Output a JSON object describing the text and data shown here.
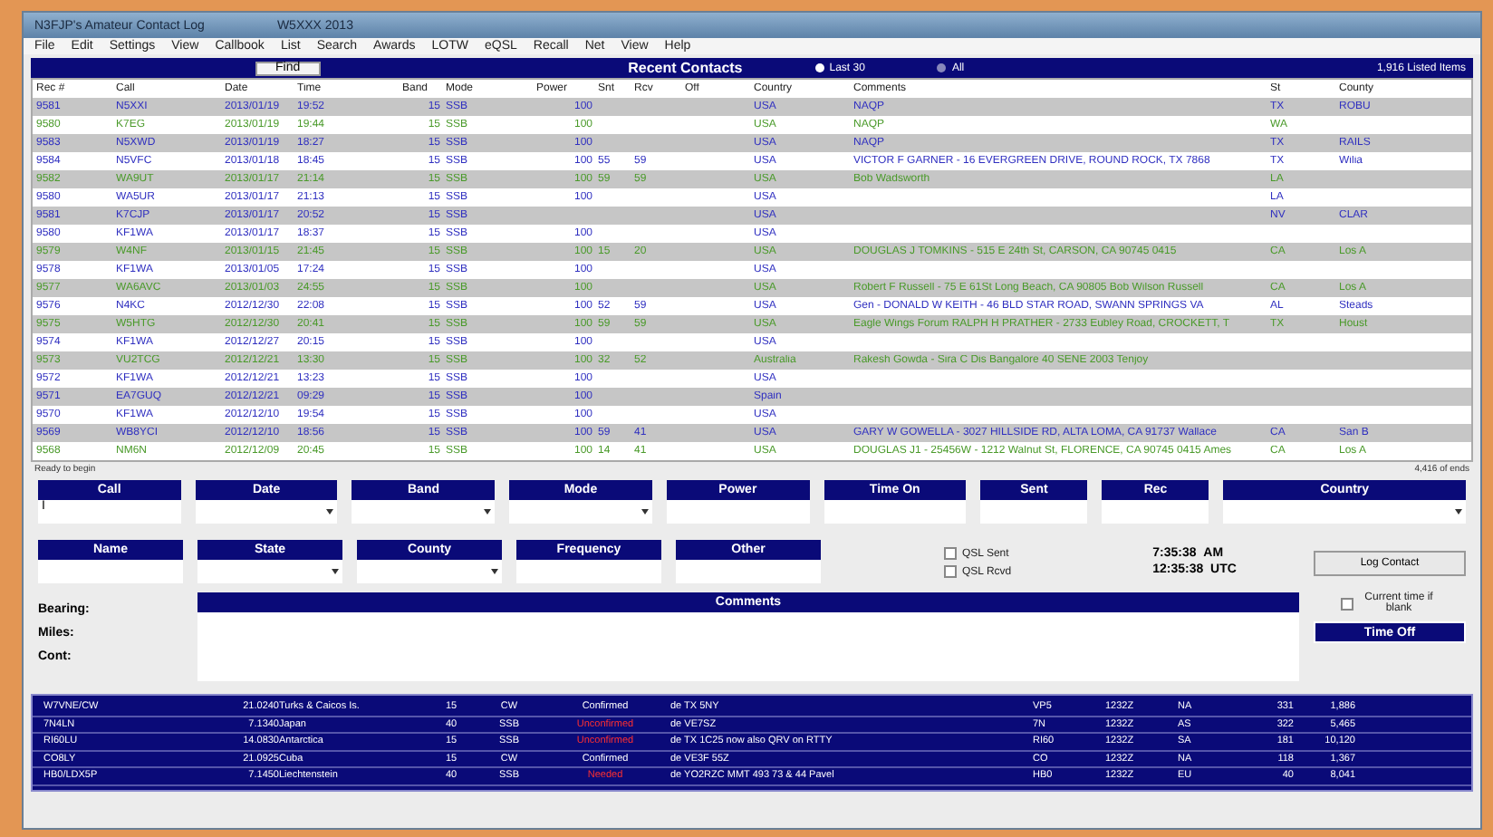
{
  "window": {
    "title": "N3FJP's Amateur Contact Log",
    "subtitle": "W5XXX 2013"
  },
  "menu": [
    "File",
    "Edit",
    "Settings",
    "View",
    "Callbook",
    "List",
    "Search",
    "Awards",
    "LOTW",
    "eQSL",
    "Recall",
    "Net",
    "View",
    "Help"
  ],
  "header": {
    "find_button": "Find",
    "title": "Recent Contacts",
    "filters": [
      {
        "label": "Last 30",
        "selected": true
      },
      {
        "label": "All",
        "selected": false
      }
    ],
    "count": "1,916 Listed Items"
  },
  "columns": [
    "Rec #",
    "Call",
    "Date",
    "Time",
    "Band",
    "Mode",
    "Power",
    "Snt",
    "Rcv",
    "Off",
    "Country",
    "Comments",
    "St",
    "County"
  ],
  "rows": [
    {
      "cells": [
        "9581",
        "N5XXI",
        "2013/01/19",
        "19:52",
        "15",
        "SSB",
        "100",
        null,
        null,
        null,
        "USA",
        "NAQP",
        "TX",
        "ROBU"
      ],
      "color": "#3030c0"
    },
    {
      "cells": [
        "9580",
        "K7EG",
        "2013/01/19",
        "19:44",
        "15",
        "SSB",
        "100",
        null,
        null,
        null,
        "USA",
        "NAQP",
        "WA",
        null
      ],
      "color": "#4a9a2a"
    },
    {
      "cells": [
        "9583",
        "N5XWD",
        "2013/01/19",
        "18:27",
        "15",
        "SSB",
        "100",
        null,
        null,
        null,
        "USA",
        "NAQP",
        "TX",
        "RAILS"
      ],
      "color": "#3030c0"
    },
    {
      "cells": [
        "9584",
        "N5VFC",
        "2013/01/18",
        "18:45",
        "15",
        "SSB",
        "100",
        "55",
        "59",
        null,
        "USA",
        "VICTOR F GARNER - 16 EVERGREEN DRIVE, ROUND ROCK, TX 7868",
        "TX",
        "Wilia"
      ],
      "color": "#3030c0"
    },
    {
      "cells": [
        "9582",
        "WA9UT",
        "2013/01/17",
        "21:14",
        "15",
        "SSB",
        "100",
        "59",
        "59",
        null,
        "USA",
        "Bob Wadsworth",
        "LA",
        null
      ],
      "color": "#4a9a2a"
    },
    {
      "cells": [
        "9580",
        "WA5UR",
        "2013/01/17",
        "21:13",
        "15",
        "SSB",
        "100",
        null,
        null,
        null,
        "USA",
        null,
        "LA",
        null
      ],
      "color": "#3030c0"
    },
    {
      "cells": [
        "9581",
        "K7CJP",
        "2013/01/17",
        "20:52",
        "15",
        "SSB",
        null,
        null,
        null,
        null,
        "USA",
        null,
        "NV",
        "CLAR"
      ],
      "color": "#3030c0"
    },
    {
      "cells": [
        "9580",
        "KF1WA",
        "2013/01/17",
        "18:37",
        "15",
        "SSB",
        "100",
        null,
        null,
        null,
        "USA",
        null,
        null,
        null
      ],
      "color": "#3030c0"
    },
    {
      "cells": [
        "9579",
        "W4NF",
        "2013/01/15",
        "21:45",
        "15",
        "SSB",
        "100",
        "15",
        "20",
        null,
        "USA",
        "DOUGLAS J TOMKINS - 515 E 24th St, CARSON, CA 90745 0415",
        "CA",
        "Los A"
      ],
      "color": "#4a9a2a"
    },
    {
      "cells": [
        "9578",
        "KF1WA",
        "2013/01/05",
        "17:24",
        "15",
        "SSB",
        "100",
        null,
        null,
        null,
        "USA",
        null,
        null,
        null
      ],
      "color": "#3030c0"
    },
    {
      "cells": [
        "9577",
        "WA6AVC",
        "2013/01/03",
        "24:55",
        "15",
        "SSB",
        "100",
        null,
        null,
        null,
        "USA",
        "Robert F Russell - 75 E 61St Long Beach, CA 90805 Bob Wilson Russell",
        "CA",
        "Los A"
      ],
      "color": "#4a9a2a"
    },
    {
      "cells": [
        "9576",
        "N4KC",
        "2012/12/30",
        "22:08",
        "15",
        "SSB",
        "100",
        "52",
        "59",
        null,
        "USA",
        "Gen - DONALD W KEITH - 46 BLD STAR ROAD, SWANN SPRINGS VA",
        "AL",
        "Steads"
      ],
      "color": "#3030c0"
    },
    {
      "cells": [
        "9575",
        "W5HTG",
        "2012/12/30",
        "20:41",
        "15",
        "SSB",
        "100",
        "59",
        "59",
        null,
        "USA",
        "Eagle Wings Forum RALPH H PRATHER - 2733 Eubley Road, CROCKETT, T",
        "TX",
        "Houst"
      ],
      "color": "#4a9a2a"
    },
    {
      "cells": [
        "9574",
        "KF1WA",
        "2012/12/27",
        "20:15",
        "15",
        "SSB",
        "100",
        null,
        null,
        null,
        "USA",
        null,
        null,
        null
      ],
      "color": "#3030c0"
    },
    {
      "cells": [
        "9573",
        "VU2TCG",
        "2012/12/21",
        "13:30",
        "15",
        "SSB",
        "100",
        "32",
        "52",
        null,
        "Australia",
        "Rakesh Gowda - Sira C Dis Bangalore 40 SENE 2003 Tenjoy",
        null,
        null
      ],
      "color": "#4a9a2a"
    },
    {
      "cells": [
        "9572",
        "KF1WA",
        "2012/12/21",
        "13:23",
        "15",
        "SSB",
        "100",
        null,
        null,
        null,
        "USA",
        null,
        null,
        null
      ],
      "color": "#3030c0"
    },
    {
      "cells": [
        "9571",
        "EA7GUQ",
        "2012/12/21",
        "09:29",
        "15",
        "SSB",
        "100",
        null,
        null,
        null,
        "Spain",
        null,
        null,
        null
      ],
      "color": "#3030c0"
    },
    {
      "cells": [
        "9570",
        "KF1WA",
        "2012/12/10",
        "19:54",
        "15",
        "SSB",
        "100",
        null,
        null,
        null,
        "USA",
        null,
        null,
        null
      ],
      "color": "#3030c0"
    },
    {
      "cells": [
        "9569",
        "WB8YCI",
        "2012/12/10",
        "18:56",
        "15",
        "SSB",
        "100",
        "59",
        "41",
        null,
        "USA",
        "GARY W GOWELLA - 3027 HILLSIDE RD, ALTA LOMA, CA 91737 Wallace",
        "CA",
        "San B"
      ],
      "color": "#3030c0"
    },
    {
      "cells": [
        "9568",
        "NM6N",
        "2012/12/09",
        "20:45",
        "15",
        "SSB",
        "100",
        "14",
        "41",
        null,
        "USA",
        "DOUGLAS J1 - 25456W - 1212 Walnut St, FLORENCE, CA 90745 0415 Ames",
        "CA",
        "Los A"
      ],
      "color": "#4a9a2a"
    }
  ],
  "status": {
    "left": "Ready to begin",
    "right": "4,416 of ends"
  },
  "fields_row1": [
    {
      "label": "Call",
      "value": "I",
      "dropdown": false
    },
    {
      "label": "Date",
      "dropdown": true
    },
    {
      "label": "Band",
      "dropdown": true
    },
    {
      "label": "Mode",
      "dropdown": true
    },
    {
      "label": "Power",
      "dropdown": false
    },
    {
      "label": "Time On",
      "dropdown": false
    },
    {
      "label": "Sent",
      "dropdown": false
    },
    {
      "label": "Rec",
      "dropdown": false
    },
    {
      "label": "Country",
      "dropdown": true
    }
  ],
  "fields_row2": [
    {
      "label": "Name",
      "dropdown": false
    },
    {
      "label": "State",
      "dropdown": true
    },
    {
      "label": "County",
      "dropdown": true
    },
    {
      "label": "Frequency",
      "dropdown": false
    },
    {
      "label": "Other",
      "dropdown": false
    }
  ],
  "qsl": [
    {
      "label": "QSL Sent",
      "checked": false
    },
    {
      "label": "QSL Rcvd",
      "checked": false
    }
  ],
  "clock": [
    {
      "time": "7:35:38",
      "zone": "AM"
    },
    {
      "time": "12:35:38",
      "zone": "UTC"
    }
  ],
  "log_button": "Log Contact",
  "info_labels": [
    "Bearing:",
    "Miles:",
    "Cont:"
  ],
  "comments_label": "Comments",
  "current_time": {
    "label": "Current time if blank",
    "checked": false
  },
  "time_off_button": "Time Off",
  "spots": [
    {
      "cells": [
        "W7VNE/CW",
        "21.0240",
        "Turks & Caicos Is.",
        "15",
        "CW",
        "Confirmed",
        "de TX 5NY",
        "VP5",
        "1232Z",
        "NA",
        "331",
        "1,886"
      ],
      "confirmed": true
    },
    {
      "cells": [
        "7N4LN",
        "7.1340",
        "Japan",
        "40",
        "SSB",
        "Unconfirmed",
        "de VE7SZ",
        "7N",
        "1232Z",
        "AS",
        "322",
        "5,465"
      ],
      "confirmed": false
    },
    {
      "cells": [
        "RI60LU",
        "14.0830",
        "Antarctica",
        "15",
        "SSB",
        "Unconfirmed",
        "de TX 1C25 now also QRV on RTTY",
        "RI60",
        "1232Z",
        "SA",
        "181",
        "10,120"
      ],
      "confirmed": false
    },
    {
      "cells": [
        "CO8LY",
        "21.0925",
        "Cuba",
        "15",
        "CW",
        "Confirmed",
        "de VE3F 55Z",
        "CO",
        "1232Z",
        "NA",
        "118",
        "1,367"
      ],
      "confirmed": true
    },
    {
      "cells": [
        "HB0/LDX5P",
        "7.1450",
        "Liechtenstein",
        "40",
        "SSB",
        "Needed",
        "de YO2RZC MMT 493 73 & 44 Pavel",
        "HB0",
        "1232Z",
        "EU",
        "40",
        "8,041"
      ],
      "confirmed": false
    }
  ]
}
